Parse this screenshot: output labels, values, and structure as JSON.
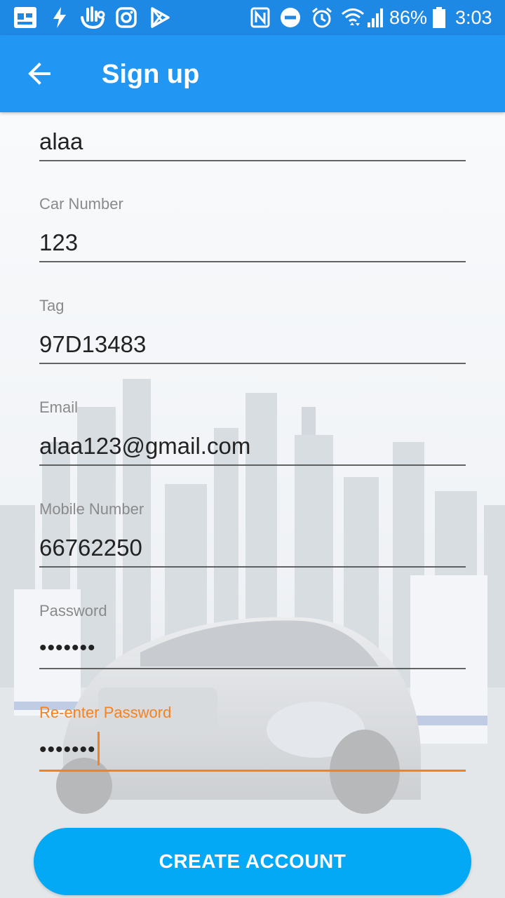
{
  "status_bar": {
    "battery_percent": "86%",
    "time": "3:03",
    "icons": [
      "screen-icon",
      "bolt-icon",
      "touch-icon",
      "instagram-icon",
      "play-store-icon",
      "nfc-icon",
      "dnd-icon",
      "alarm-icon",
      "wifi-icon",
      "signal-icon",
      "battery-icon"
    ]
  },
  "app_bar": {
    "title": "Sign up",
    "back_icon": "arrow-back-icon",
    "color": "#2196f3"
  },
  "form": {
    "name": {
      "value": "alaa"
    },
    "car_number": {
      "label": "Car Number",
      "value": "123"
    },
    "tag": {
      "label": "Tag",
      "value": "97D13483"
    },
    "email": {
      "label": "Email",
      "value": "alaa123@gmail.com"
    },
    "mobile": {
      "label": "Mobile Number",
      "value": "66762250"
    },
    "password": {
      "label": "Password",
      "value": "•••••••"
    },
    "reenter_password": {
      "label": "Re-enter Password",
      "value": "•••••••"
    },
    "accent_color": "#f5821f"
  },
  "actions": {
    "create_account": "CREATE ACCOUNT",
    "button_color": "#03a9f4"
  }
}
